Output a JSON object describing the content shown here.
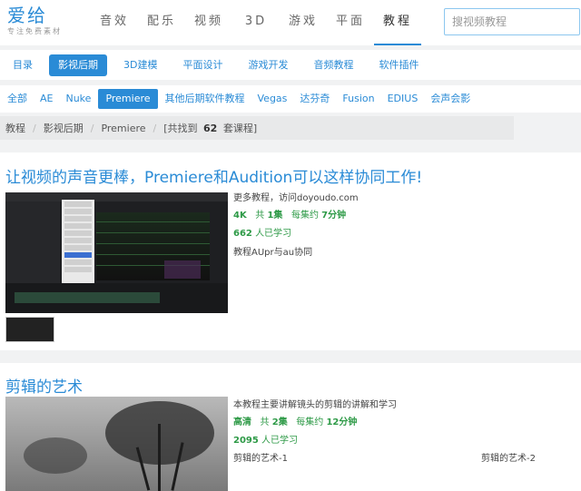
{
  "logo": {
    "name": "爱给",
    "tagline": "专注免费素材"
  },
  "main_nav": [
    {
      "label": "音效",
      "active": false
    },
    {
      "label": "配乐",
      "active": false
    },
    {
      "label": "视频",
      "active": false
    },
    {
      "label": "3D",
      "active": false
    },
    {
      "label": "游戏",
      "active": false
    },
    {
      "label": "平面",
      "active": false
    },
    {
      "label": "教程",
      "active": true
    }
  ],
  "search": {
    "placeholder": "搜视频教程"
  },
  "sub_nav": [
    {
      "label": "目录",
      "active": false
    },
    {
      "label": "影视后期",
      "active": true
    },
    {
      "label": "3D建模",
      "active": false
    },
    {
      "label": "平面设计",
      "active": false
    },
    {
      "label": "游戏开发",
      "active": false
    },
    {
      "label": "音频教程",
      "active": false
    },
    {
      "label": "软件插件",
      "active": false
    }
  ],
  "filter": [
    {
      "label": "全部",
      "active": false
    },
    {
      "label": "AE",
      "active": false
    },
    {
      "label": "Nuke",
      "active": false
    },
    {
      "label": "Premiere",
      "active": true
    },
    {
      "label": "其他后期软件教程",
      "active": false
    },
    {
      "label": "Vegas",
      "active": false
    },
    {
      "label": "达芬奇",
      "active": false
    },
    {
      "label": "Fusion",
      "active": false
    },
    {
      "label": "EDIUS",
      "active": false
    },
    {
      "label": "会声会影",
      "active": false
    }
  ],
  "breadcrumb": {
    "items": [
      "教程",
      "影视后期",
      "Premiere"
    ],
    "result_prefix": "[共找到",
    "result_count": "62",
    "result_suffix": "套课程]"
  },
  "courses": [
    {
      "title": "让视频的声音更棒，Premiere和Audition可以这样协同工作!",
      "desc": "更多教程，访问doyoudo.com",
      "quality": "4K",
      "episodes_prefix": "共",
      "episodes": "1集",
      "duration_prefix": "每集约",
      "duration": "7分钟",
      "learners": "662",
      "learners_suffix": "人已学习",
      "tag": "教程AUpr与au协同"
    },
    {
      "title": "剪辑的艺术",
      "desc": "本教程主要讲解镜头的剪辑的讲解和学习",
      "quality": "高清",
      "episodes_prefix": "共",
      "episodes": "2集",
      "duration_prefix": "每集约",
      "duration": "12分钟",
      "learners": "2095",
      "learners_suffix": "人已学习",
      "episode_list": [
        "剪辑的艺术-1",
        "剪辑的艺术-2"
      ]
    }
  ]
}
